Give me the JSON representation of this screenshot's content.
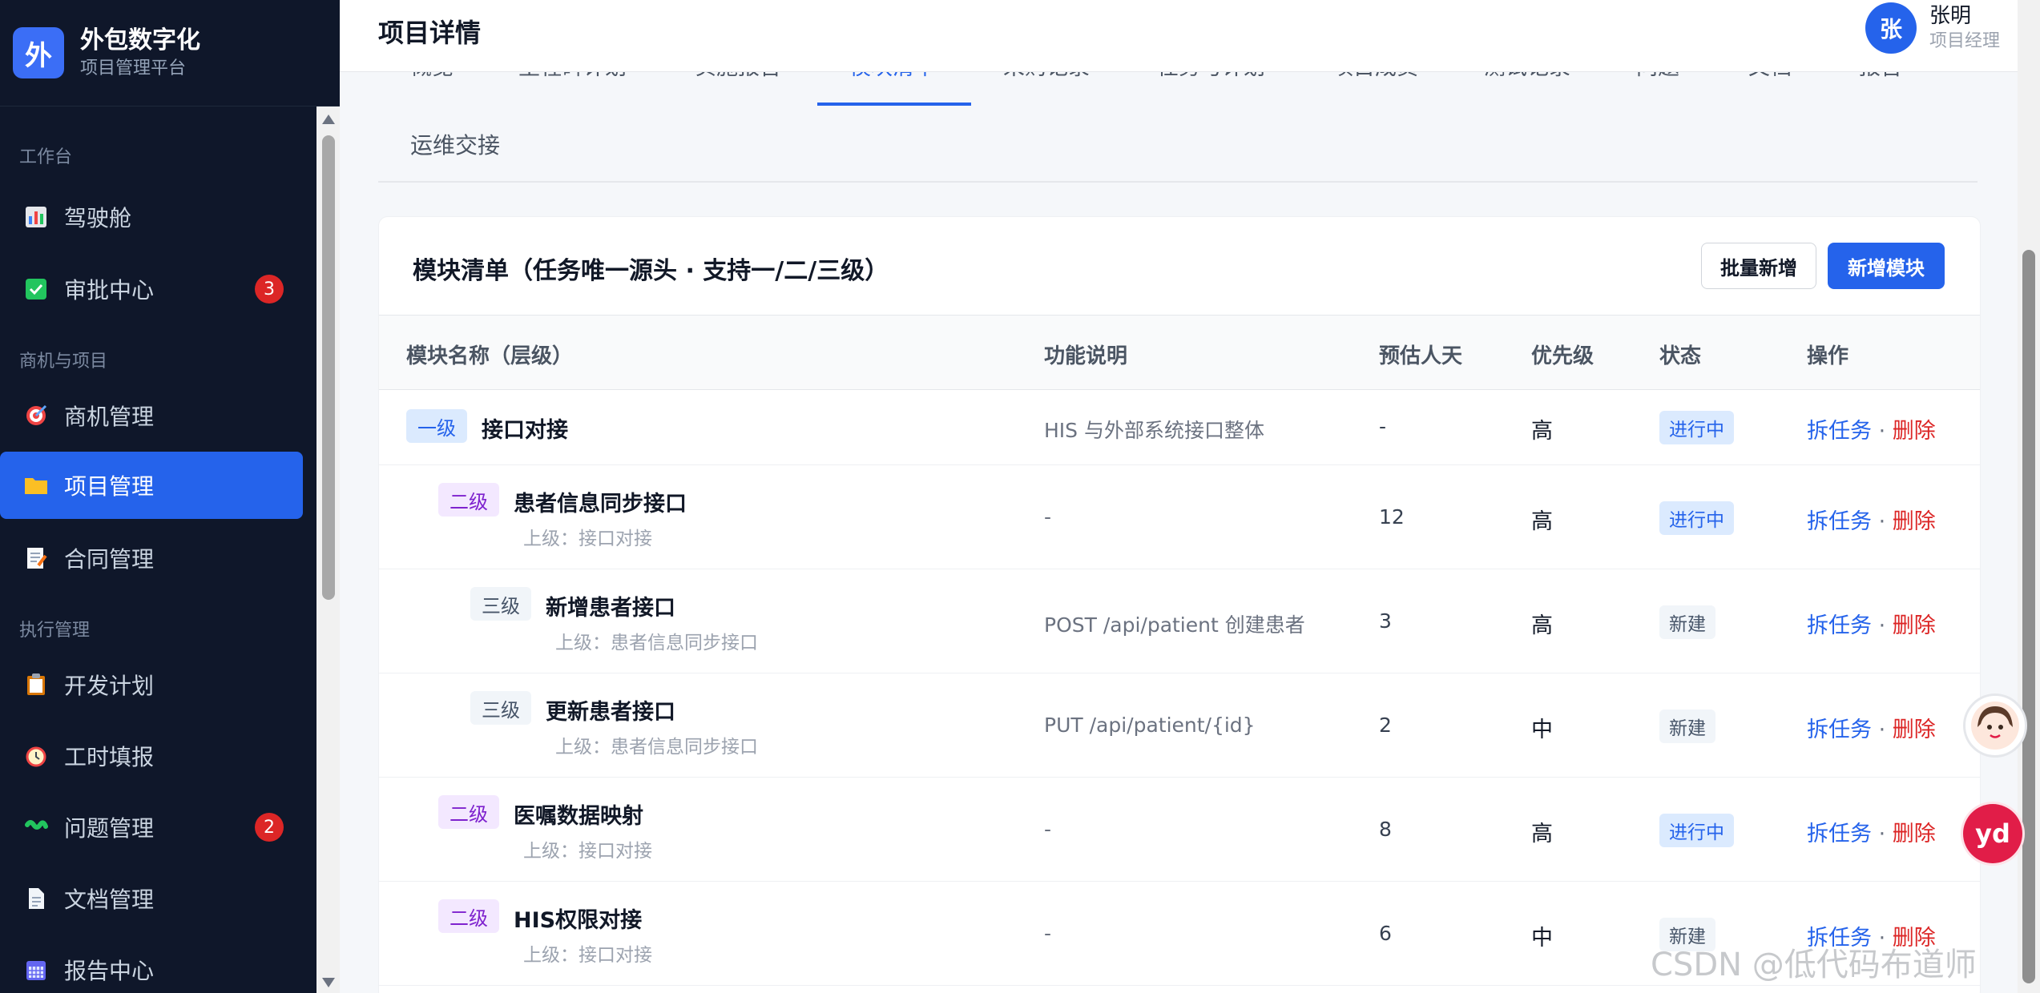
{
  "brand": {
    "logo": "外",
    "title": "外包数字化",
    "subtitle": "项目管理平台"
  },
  "sidebar": {
    "groups": [
      "工作台",
      "商机与项目",
      "执行管理"
    ],
    "items": [
      {
        "label": "驾驶舱",
        "icon": "chart-icon"
      },
      {
        "label": "审批中心",
        "icon": "check-icon",
        "badge": "3"
      },
      {
        "label": "商机管理",
        "icon": "target-icon"
      },
      {
        "label": "项目管理",
        "icon": "folder-icon",
        "active": true
      },
      {
        "label": "合同管理",
        "icon": "contract-icon"
      },
      {
        "label": "开发计划",
        "icon": "clipboard-icon"
      },
      {
        "label": "工时填报",
        "icon": "clock-icon"
      },
      {
        "label": "问题管理",
        "icon": "bug-icon",
        "badge": "2"
      },
      {
        "label": "文档管理",
        "icon": "document-icon"
      },
      {
        "label": "报告中心",
        "icon": "calendar-icon"
      }
    ]
  },
  "header": {
    "title": "项目详情",
    "user": {
      "avatar": "张",
      "name": "张明",
      "role": "项目经理"
    }
  },
  "tabs": {
    "row1": [
      "概览",
      "里程碑计划",
      "实施报告",
      "模块清单",
      "采购记录",
      "任务与计划",
      "项目成员",
      "测试记录",
      "问题",
      "文档",
      "报告"
    ],
    "active": "模块清单",
    "row2": "运维交接"
  },
  "card": {
    "title": "模块清单（任务唯一源头 · 支持一/二/三级）",
    "batch_add": "批量新增",
    "add_module": "新增模块"
  },
  "table": {
    "headers": [
      "模块名称（层级）",
      "功能说明",
      "预估人天",
      "优先级",
      "状态",
      "操作"
    ],
    "rows": [
      {
        "level": "一级",
        "name": "接口对接",
        "parent": "",
        "desc": "HIS 与外部系统接口整体",
        "days": "-",
        "priority": "高",
        "status": "进行中"
      },
      {
        "level": "二级",
        "name": "患者信息同步接口",
        "parent": "上级：接口对接",
        "desc": "-",
        "days": "12",
        "priority": "高",
        "status": "进行中"
      },
      {
        "level": "三级",
        "name": "新增患者接口",
        "parent": "上级：患者信息同步接口",
        "desc": "POST /api/patient 创建患者",
        "days": "3",
        "priority": "高",
        "status": "新建"
      },
      {
        "level": "三级",
        "name": "更新患者接口",
        "parent": "上级：患者信息同步接口",
        "desc": "PUT /api/patient/{id}",
        "days": "2",
        "priority": "中",
        "status": "新建"
      },
      {
        "level": "二级",
        "name": "医嘱数据映射",
        "parent": "上级：接口对接",
        "desc": "-",
        "days": "8",
        "priority": "高",
        "status": "进行中"
      },
      {
        "level": "二级",
        "name": "HIS权限对接",
        "parent": "上级：接口对接",
        "desc": "-",
        "days": "6",
        "priority": "中",
        "status": "新建"
      }
    ],
    "op_split": "拆任务",
    "op_sep": "·",
    "op_delete": "删除"
  },
  "floating": {
    "yd_label": "yd"
  },
  "watermark": "CSDN @低代码布道师",
  "colors": {
    "sidebar_bg": "#0f172a",
    "accent": "#2563eb",
    "danger": "#dc2626"
  }
}
